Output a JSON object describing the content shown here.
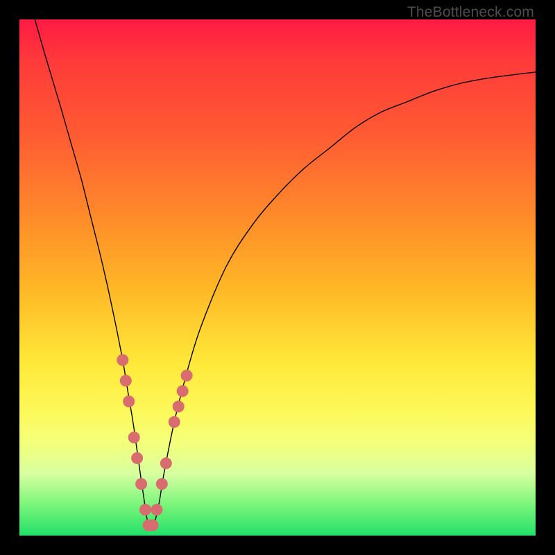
{
  "watermark": "TheBottleneck.com",
  "chart_data": {
    "type": "line",
    "title": "",
    "xlabel": "",
    "ylabel": "",
    "xlim": [
      0,
      100
    ],
    "ylim": [
      0,
      100
    ],
    "series": [
      {
        "name": "bottleneck-curve",
        "x": [
          3,
          5,
          8,
          10,
          12,
          14,
          16,
          18,
          20,
          21,
          22,
          23,
          24,
          25,
          26,
          27,
          28,
          30,
          32,
          35,
          40,
          45,
          50,
          55,
          60,
          65,
          70,
          75,
          80,
          85,
          90,
          95,
          100
        ],
        "y": [
          100,
          93,
          83,
          76,
          69,
          61,
          53,
          44,
          34,
          28,
          22,
          15,
          8,
          2,
          2,
          6,
          12,
          22,
          30,
          40,
          52,
          60,
          66,
          71,
          75,
          79,
          82,
          84,
          86,
          87.5,
          88.5,
          89.2,
          89.8
        ]
      }
    ],
    "markers": {
      "name": "highlighted-points",
      "color": "#d86c6f",
      "points": [
        {
          "x": 20.0,
          "y": 34
        },
        {
          "x": 20.6,
          "y": 30
        },
        {
          "x": 21.2,
          "y": 26
        },
        {
          "x": 22.2,
          "y": 19
        },
        {
          "x": 22.8,
          "y": 15
        },
        {
          "x": 23.6,
          "y": 10
        },
        {
          "x": 24.4,
          "y": 5
        },
        {
          "x": 25.0,
          "y": 2
        },
        {
          "x": 25.8,
          "y": 2
        },
        {
          "x": 26.6,
          "y": 5
        },
        {
          "x": 27.6,
          "y": 10
        },
        {
          "x": 28.4,
          "y": 14
        },
        {
          "x": 30.0,
          "y": 22
        },
        {
          "x": 30.8,
          "y": 25
        },
        {
          "x": 31.6,
          "y": 28
        },
        {
          "x": 32.4,
          "y": 31
        }
      ]
    },
    "gradient_stops": [
      {
        "pos": 0,
        "color": "#ff1a44"
      },
      {
        "pos": 8,
        "color": "#ff3a3a"
      },
      {
        "pos": 22,
        "color": "#ff5a33"
      },
      {
        "pos": 38,
        "color": "#ff8a2a"
      },
      {
        "pos": 52,
        "color": "#ffb726"
      },
      {
        "pos": 66,
        "color": "#ffe738"
      },
      {
        "pos": 76,
        "color": "#fdf95a"
      },
      {
        "pos": 82,
        "color": "#f4ff7a"
      },
      {
        "pos": 88,
        "color": "#d8ffa0"
      },
      {
        "pos": 94,
        "color": "#7bf57b"
      },
      {
        "pos": 100,
        "color": "#22e06a"
      }
    ]
  }
}
